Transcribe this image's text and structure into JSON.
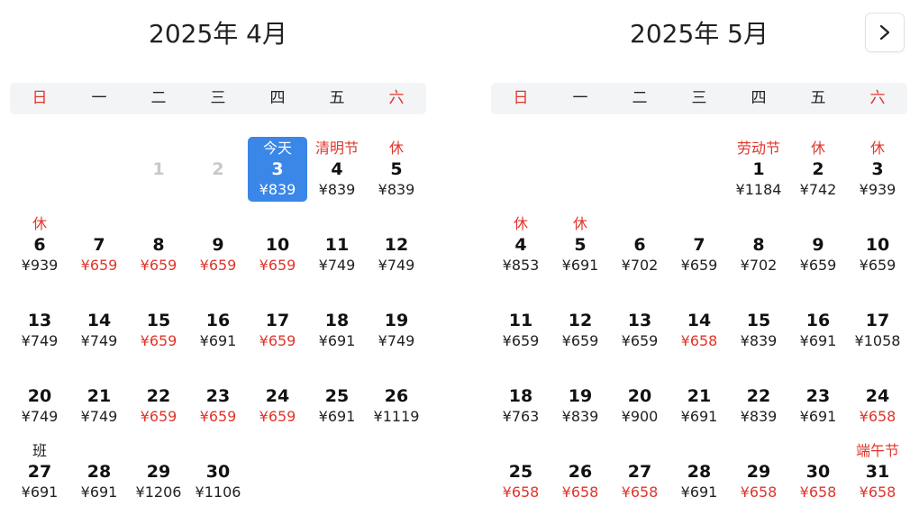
{
  "colors": {
    "accent": "#3a87e8",
    "holiday_red": "#e0352b",
    "weekday_bar": "#f3f4f6"
  },
  "next_button": {
    "icon": "chevron-right-icon"
  },
  "weekday_labels": [
    "日",
    "一",
    "二",
    "三",
    "四",
    "五",
    "六"
  ],
  "months": [
    {
      "title": "2025年 4月",
      "leading_blanks": 2,
      "days": [
        {
          "day": "1",
          "state": "past"
        },
        {
          "day": "2",
          "state": "past"
        },
        {
          "day": "3",
          "tag": "今天",
          "price": "¥839",
          "state": "today"
        },
        {
          "day": "4",
          "tag": "清明节",
          "price": "¥839"
        },
        {
          "day": "5",
          "tag": "休",
          "price": "¥839"
        },
        {
          "day": "6",
          "tag": "休",
          "price": "¥939"
        },
        {
          "day": "7",
          "price": "¥659",
          "low": true
        },
        {
          "day": "8",
          "price": "¥659",
          "low": true
        },
        {
          "day": "9",
          "price": "¥659",
          "low": true
        },
        {
          "day": "10",
          "price": "¥659",
          "low": true
        },
        {
          "day": "11",
          "price": "¥749"
        },
        {
          "day": "12",
          "price": "¥749"
        },
        {
          "day": "13",
          "price": "¥749"
        },
        {
          "day": "14",
          "price": "¥749"
        },
        {
          "day": "15",
          "price": "¥659",
          "low": true
        },
        {
          "day": "16",
          "price": "¥691"
        },
        {
          "day": "17",
          "price": "¥659",
          "low": true
        },
        {
          "day": "18",
          "price": "¥691"
        },
        {
          "day": "19",
          "price": "¥749"
        },
        {
          "day": "20",
          "price": "¥749"
        },
        {
          "day": "21",
          "price": "¥749"
        },
        {
          "day": "22",
          "price": "¥659",
          "low": true
        },
        {
          "day": "23",
          "price": "¥659",
          "low": true
        },
        {
          "day": "24",
          "price": "¥659",
          "low": true
        },
        {
          "day": "25",
          "price": "¥691"
        },
        {
          "day": "26",
          "price": "¥1119"
        },
        {
          "day": "27",
          "tag": "班",
          "tag_type": "work",
          "price": "¥691"
        },
        {
          "day": "28",
          "price": "¥691"
        },
        {
          "day": "29",
          "price": "¥1206"
        },
        {
          "day": "30",
          "price": "¥1106"
        }
      ]
    },
    {
      "title": "2025年 5月",
      "leading_blanks": 4,
      "days": [
        {
          "day": "1",
          "tag": "劳动节",
          "price": "¥1184"
        },
        {
          "day": "2",
          "tag": "休",
          "price": "¥742"
        },
        {
          "day": "3",
          "tag": "休",
          "price": "¥939"
        },
        {
          "day": "4",
          "tag": "休",
          "price": "¥853"
        },
        {
          "day": "5",
          "tag": "休",
          "price": "¥691"
        },
        {
          "day": "6",
          "price": "¥702"
        },
        {
          "day": "7",
          "price": "¥659"
        },
        {
          "day": "8",
          "price": "¥702"
        },
        {
          "day": "9",
          "price": "¥659"
        },
        {
          "day": "10",
          "price": "¥659"
        },
        {
          "day": "11",
          "price": "¥659"
        },
        {
          "day": "12",
          "price": "¥659"
        },
        {
          "day": "13",
          "price": "¥659"
        },
        {
          "day": "14",
          "price": "¥658",
          "low": true
        },
        {
          "day": "15",
          "price": "¥839"
        },
        {
          "day": "16",
          "price": "¥691"
        },
        {
          "day": "17",
          "price": "¥1058"
        },
        {
          "day": "18",
          "price": "¥763"
        },
        {
          "day": "19",
          "price": "¥839"
        },
        {
          "day": "20",
          "price": "¥900"
        },
        {
          "day": "21",
          "price": "¥691"
        },
        {
          "day": "22",
          "price": "¥839"
        },
        {
          "day": "23",
          "price": "¥691"
        },
        {
          "day": "24",
          "price": "¥658",
          "low": true
        },
        {
          "day": "25",
          "price": "¥658",
          "low": true
        },
        {
          "day": "26",
          "price": "¥658",
          "low": true
        },
        {
          "day": "27",
          "price": "¥658",
          "low": true
        },
        {
          "day": "28",
          "price": "¥691"
        },
        {
          "day": "29",
          "price": "¥658",
          "low": true
        },
        {
          "day": "30",
          "price": "¥658",
          "low": true
        },
        {
          "day": "31",
          "tag": "端午节",
          "price": "¥658",
          "low": true
        }
      ]
    }
  ]
}
